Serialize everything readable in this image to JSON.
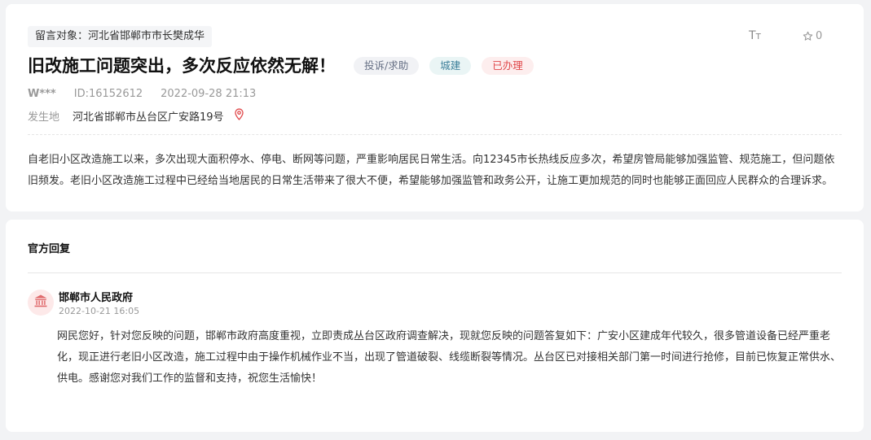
{
  "message": {
    "recipient_label": "留言对象：河北省邯郸市市长樊成华",
    "title": "旧改施工问题突出，多次反应依然无解！",
    "tags": {
      "type": "投诉/求助",
      "category": "城建",
      "status": "已办理"
    },
    "user": "W***",
    "id_label": "ID:16152612",
    "datetime": "2022-09-28 21:13",
    "location_label": "发生地",
    "location": "河北省邯郸市丛台区广安路19号",
    "content": "自老旧小区改造施工以来，多次出现大面积停水、停电、断网等问题，严重影响居民日常生活。向12345市长热线反应多次，希望房管局能够加强监管、规范施工，但问题依旧频发。老旧小区改造施工过程中已经给当地居民的日常生活带来了很大不便，希望能够加强监管和政务公开，让施工更加规范的同时也能够正面回应人民群众的合理诉求。"
  },
  "toolbar": {
    "font_size_label": "TT",
    "like_count": "0"
  },
  "reply": {
    "heading": "官方回复",
    "organization": "邯郸市人民政府",
    "datetime": "2022-10-21 16:05",
    "content": "网民您好，针对您反映的问题，邯郸市政府高度重视，立即责成丛台区政府调查解决，现就您反映的问题答复如下：广安小区建成年代较久，很多管道设备已经严重老化，现正进行老旧小区改造，施工过程中由于操作机械作业不当，出现了管道破裂、线缆断裂等情况。丛台区已对接相关部门第一时间进行抢修，目前已恢复正常供水、供电。感谢您对我们工作的监督和支持，祝您生活愉快！"
  },
  "colors": {
    "accent_red": "#e0484a",
    "tag_category_text": "#3d7f9a"
  },
  "icons": {
    "location": "location-pin-icon",
    "like": "star-outline-icon",
    "font": "font-size-icon",
    "avatar": "government-building-icon"
  }
}
